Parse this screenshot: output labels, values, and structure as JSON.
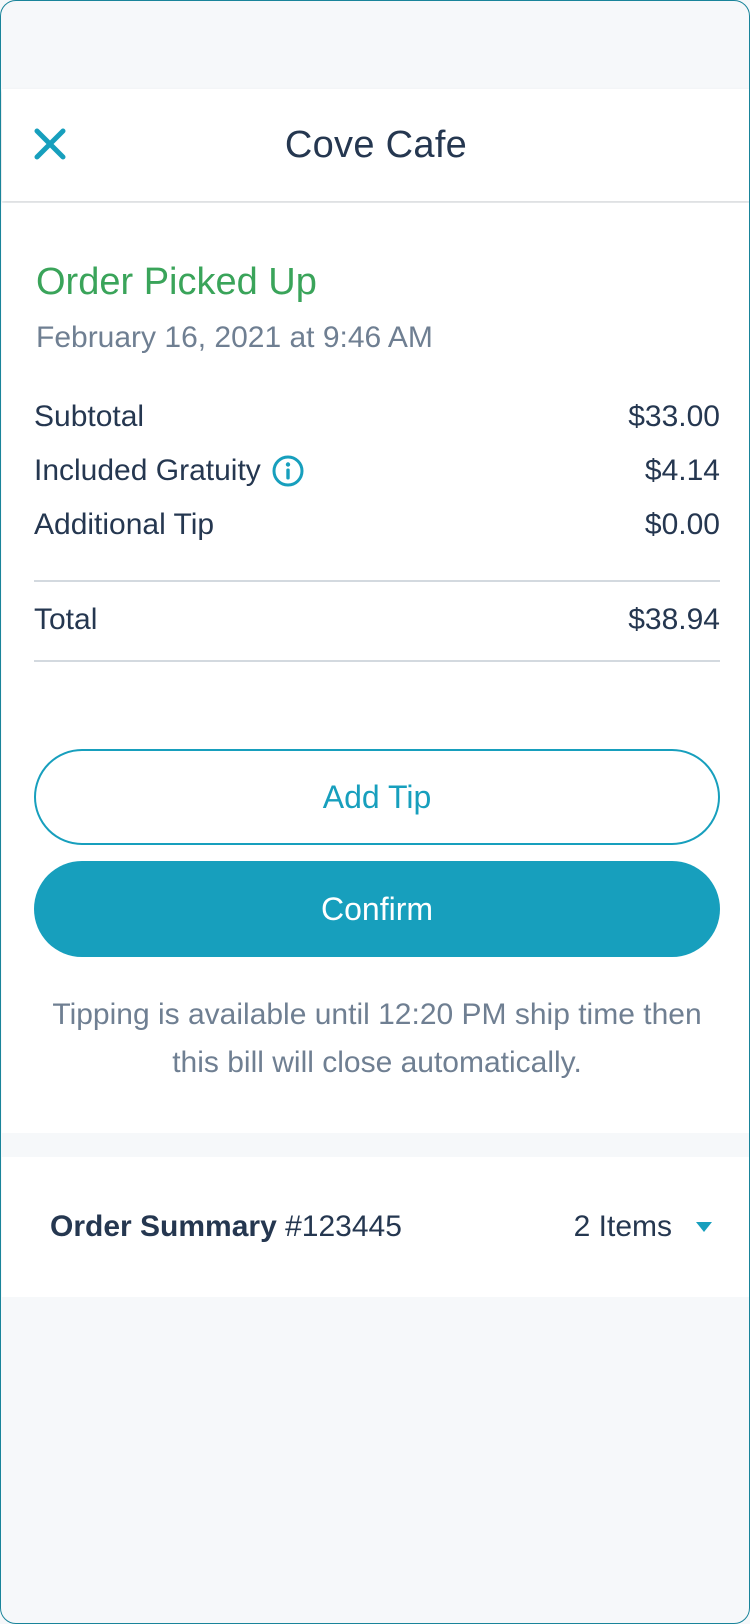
{
  "header": {
    "title": "Cove Cafe",
    "close_icon": "close-icon"
  },
  "order": {
    "status": "Order Picked Up",
    "datetime": "February 16, 2021 at 9:46 AM"
  },
  "lines": [
    {
      "label": "Subtotal",
      "amount": "$33.00"
    },
    {
      "label": "Included Gratuity",
      "amount": "$4.14",
      "icon": "info-icon"
    },
    {
      "label": "Additional Tip",
      "amount": "$0.00"
    }
  ],
  "total": {
    "label": "Total",
    "amount": "$38.94"
  },
  "buttons": {
    "add_tip": "Add Tip",
    "confirm": "Confirm"
  },
  "note": "Tipping is available until 12:20 PM ship time then this bill will close automatically.",
  "summary": {
    "label": "Order Summary",
    "order_number": "#123445",
    "items": "2 Items"
  },
  "colors": {
    "accent": "#179fbd",
    "status_green": "#3aa45a",
    "text_dark": "#253750",
    "text_muted": "#6f7f92"
  }
}
